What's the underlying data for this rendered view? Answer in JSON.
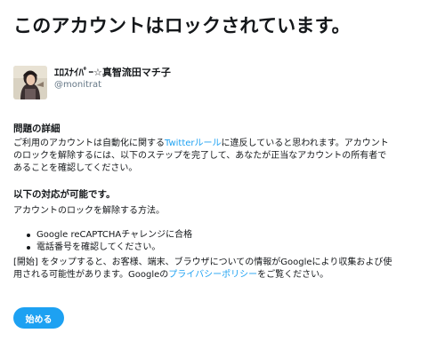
{
  "headline": "このアカウントはロックされています。",
  "user": {
    "display_name": "ｴﾛｽﾅｲﾊﾟｰ☆真智流田マチ子",
    "handle": "@monitrat"
  },
  "details": {
    "title": "問題の詳細",
    "line1_before": "ご利用のアカウントは自動化に関する",
    "rules_link": "Twitterルール",
    "line1_after": "に違反していると思われます。アカウント",
    "line2": "のロックを解除するには、以下のステップを完了して、あなたが正当なアカウントの所有者で",
    "line3": "あることを確認してください。"
  },
  "actions": {
    "title": "以下の対応が可能です。",
    "intro": "アカウントのロックを解除する方法。",
    "steps": [
      "Google reCAPTCHAチャレンジに合格",
      "電話番号を確認してください。"
    ]
  },
  "notice": {
    "line1": "[開始] をタップすると、お客様、端末、ブラウザについての情報がGoogleにより収集および使",
    "line2_before": "用される可能性があります。Googleの",
    "privacy_link": "プライバシーポリシー",
    "line2_after": "をご覧ください。"
  },
  "start_button": "始める",
  "colors": {
    "accent": "#1da1f2",
    "text": "#14171a",
    "muted": "#657786"
  }
}
